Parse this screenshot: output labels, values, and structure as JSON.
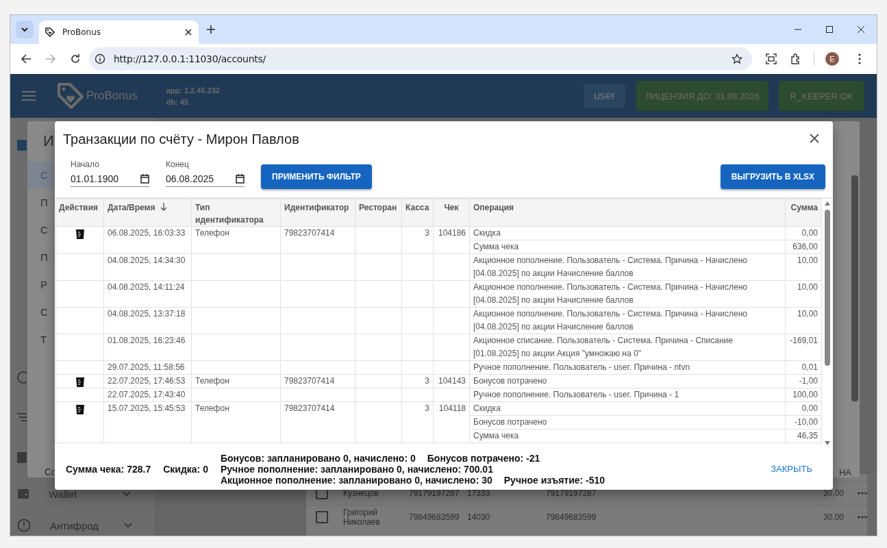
{
  "browser": {
    "tab_title": "ProBonus",
    "url": "http://127.0.0.1:11030/accounts/",
    "profile_initial": "E"
  },
  "header": {
    "logo_text": "ProBonus",
    "app_version": "app: 1.2.45.232",
    "db_version": "db: 45",
    "user": "user",
    "license": "ЛИЦЕНЗИЯ ДО: 31.08.2026",
    "status": "R_KEEPER OK"
  },
  "background": {
    "dialog_title_fragment": "И",
    "side_items": [
      {
        "label": "С",
        "selected": true
      },
      {
        "label": "П",
        "selected": false
      },
      {
        "label": "С",
        "selected": false
      },
      {
        "label": "П",
        "selected": false
      },
      {
        "label": "Р",
        "selected": false
      },
      {
        "label": "С",
        "selected": false
      },
      {
        "label": "Т",
        "selected": false
      }
    ],
    "footer_fragment": "Со",
    "column_fragment": "НА",
    "sidebar_items": [
      {
        "kind": "wallet",
        "label": "Wallet"
      },
      {
        "kind": "alert",
        "label": "Антифрод"
      }
    ],
    "rows": [
      {
        "checked": false,
        "name_lines": [
          "Кузнецов"
        ],
        "phone": "79179197287",
        "code": "17333",
        "identifier": "79179197287",
        "amount": "30,00"
      },
      {
        "checked": false,
        "name_lines": [
          "Григорий",
          "Николаев"
        ],
        "phone": "79849683599",
        "code": "14030",
        "identifier": "79849683599",
        "amount": "30,00"
      }
    ]
  },
  "dialog": {
    "title": "Транзакции по счёту - Мирон Павлов",
    "filters": [
      {
        "label": "Начало",
        "value": "01.01.1900"
      },
      {
        "label": "Конец",
        "value": "06.08.2025"
      }
    ],
    "apply_button": "ПРИМЕНИТЬ ФИЛЬТР",
    "export_button": "ВЫГРУЗИТЬ В XLSX",
    "table": {
      "columns": [
        {
          "label": "Действия",
          "sorted": false
        },
        {
          "label": "Дата/Время",
          "sorted": true
        },
        {
          "label": "Тип идентификатора",
          "sorted": false
        },
        {
          "label": "Идентификатор",
          "sorted": false
        },
        {
          "label": "Ресторан",
          "sorted": false
        },
        {
          "label": "Касса",
          "sorted": false
        },
        {
          "label": "Чек",
          "sorted": false
        },
        {
          "label": "Операция",
          "sorted": false
        },
        {
          "label": "Сумма",
          "sorted": false
        }
      ],
      "rows": [
        {
          "receipt": true,
          "datetime": "06.08.2025, 16:03:33",
          "id_type": "Телефон",
          "identifier": "79823707414",
          "cash_desk": "3",
          "check": "104186",
          "operations": [
            {
              "name": "Скидка",
              "amount": "0,00"
            },
            {
              "name": "Сумма чека",
              "amount": "636,00"
            }
          ]
        },
        {
          "receipt": false,
          "datetime": "04.08.2025, 14:34:30",
          "operations": [
            {
              "name": "Акционное пополнение. Пользователь - Система. Причина - Начислено [04.08.2025] по акции Начисление баллов",
              "amount": "10,00"
            }
          ]
        },
        {
          "receipt": false,
          "datetime": "04.08.2025, 14:11:24",
          "operations": [
            {
              "name": "Акционное пополнение. Пользователь - Система. Причина - Начислено [04.08.2025] по акции Начисление баллов",
              "amount": "10,00"
            }
          ]
        },
        {
          "receipt": false,
          "datetime": "04.08.2025, 13:37:18",
          "operations": [
            {
              "name": "Акционное пополнение. Пользователь - Система. Причина - Начислено [04.08.2025] по акции Начисление баллов",
              "amount": "10,00"
            }
          ]
        },
        {
          "receipt": false,
          "datetime": "01.08.2025, 16:23:46",
          "operations": [
            {
              "name": "Акционное списание. Пользователь - Система. Причина - Списание [01.08.2025] по акции Акция \"умножаю на 0\"",
              "amount": "-169,01"
            }
          ]
        },
        {
          "receipt": false,
          "datetime": "29.07.2025, 11:58:56",
          "operations": [
            {
              "name": "Ручное пополнение. Пользователь - user. Причина - ntvn",
              "amount": "0,01"
            }
          ]
        },
        {
          "receipt": true,
          "datetime": "22.07.2025, 17:46:53",
          "id_type": "Телефон",
          "identifier": "79823707414",
          "cash_desk": "3",
          "check": "104143",
          "operations": [
            {
              "name": "Бонусов потрачено",
              "amount": "-1,00"
            }
          ]
        },
        {
          "receipt": false,
          "datetime": "22.07.2025, 17:43:40",
          "operations": [
            {
              "name": "Ручное пополнение. Пользователь - user. Причина - 1",
              "amount": "100,00"
            }
          ]
        },
        {
          "receipt": true,
          "datetime": "15.07.2025, 15:45:53",
          "id_type": "Телефон",
          "identifier": "79823707414",
          "cash_desk": "3",
          "check": "104118",
          "operations": [
            {
              "name": "Скидка",
              "amount": "0,00"
            },
            {
              "name": "Бонусов потрачено",
              "amount": "-10,00"
            },
            {
              "name": "Сумма чека",
              "amount": "46,35"
            }
          ]
        }
      ]
    },
    "summary": {
      "totals": [
        "Сумма чека: 728.7",
        "Скидка: 0"
      ],
      "lines": [
        [
          "Бонусов: запланировано 0, начислено: 0",
          "Бонусов потрачено: -21"
        ],
        [
          "Ручное пополнение: запланировано 0, начислено: 700.01"
        ],
        [
          "Акционное пополнение: запланировано 0, начислено: 30",
          "Ручное изъятие: -510"
        ]
      ]
    },
    "close_button": "ЗАКРЫТЬ"
  }
}
